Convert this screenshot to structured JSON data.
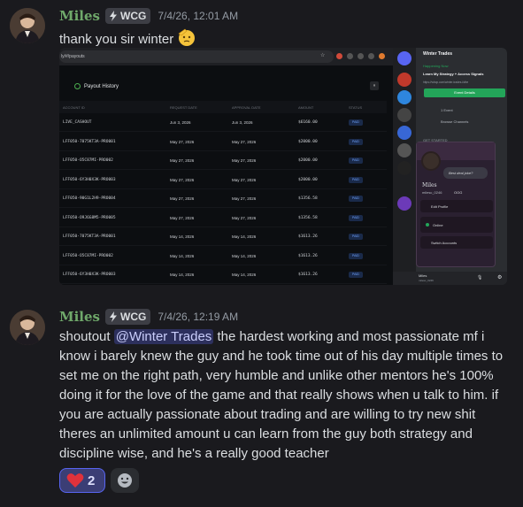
{
  "messages": [
    {
      "author": "Miles",
      "tag": "WCG",
      "timestamp": "7/4/26, 12:01 AM",
      "text": "thank you sir winter"
    },
    {
      "author": "Miles",
      "tag": "WCG",
      "timestamp": "7/4/26, 12:19 AM",
      "mention": "@Winter Trades",
      "text_before": "shoutout ",
      "text_after": " the hardest working and most passionate mf i know i barely knew the guy and he took time out of his day multiple times to set me on the right path, very humble and unlike other mentors he's 100% doing it for the love of the game and that really shows when u talk to him. if you are actually passionate about trading and are willing to try new shit theres an unlimited amount u can learn from the guy both strategy and discipline wise, and he's a really good teacher"
    }
  ],
  "attachment": {
    "url": "ly/#/payouts",
    "section_title": "Payout History",
    "columns": [
      "ACCOUNT ID",
      "REQUEST DATE",
      "APPROVAL DATE",
      "AMOUNT",
      "STATUS"
    ],
    "rows": [
      {
        "id": "LIVE_CASHOUT",
        "req": "Jun 3, 2026",
        "app": "Jun 3, 2026",
        "amt": "$6160.00",
        "status": "PAID"
      },
      {
        "id": "LFF050-7075KT3A-PRO001",
        "req": "May 27, 2026",
        "app": "May 27, 2026",
        "amt": "$2000.00",
        "status": "PAID"
      },
      {
        "id": "LFF050-O5C87MI-PRO002",
        "req": "May 27, 2026",
        "app": "May 27, 2026",
        "amt": "$2000.00",
        "status": "PAID"
      },
      {
        "id": "LFF050-6Y3H0X3K-PRO003",
        "req": "May 27, 2026",
        "app": "May 27, 2026",
        "amt": "$2000.00",
        "status": "PAID"
      },
      {
        "id": "LFF050-90G1L2H9-PRO004",
        "req": "May 27, 2026",
        "app": "May 27, 2026",
        "amt": "$1356.58",
        "status": "PAID"
      },
      {
        "id": "LFF050-O9J6G8M5-PRO005",
        "req": "May 27, 2026",
        "app": "May 27, 2026",
        "amt": "$1356.58",
        "status": "PAID"
      },
      {
        "id": "LFF050-7075KT3A-PRO001",
        "req": "May 14, 2026",
        "app": "May 14, 2026",
        "amt": "$1613.26",
        "status": "PAID"
      },
      {
        "id": "LFF050-O5C87MI-PRO002",
        "req": "May 14, 2026",
        "app": "May 14, 2026",
        "amt": "$1613.26",
        "status": "PAID"
      },
      {
        "id": "LFF050-6Y3H0X3K-PRO003",
        "req": "May 14, 2026",
        "app": "May 14, 2026",
        "amt": "$1613.26",
        "status": "PAID"
      }
    ],
    "discord": {
      "server_name": "Winter Trades",
      "happening_now": "Happening Now",
      "event_title": "Learn My Strategy + Access Signals",
      "event_link": "https://whop.com/winter-trades-iidhe",
      "event_button": "Event Details",
      "events_label": "1 Event",
      "browse_label": "Browse Channels",
      "get_started": "GET STARTED",
      "profile_status": "Best deal joke?",
      "profile_name": "Miles",
      "profile_handle": "milesc_0246",
      "profile_tag": "OOG",
      "menu": [
        "Edit Profile",
        "Online",
        "Switch Accounts"
      ],
      "footer_name": "Miles",
      "footer_handle": "milesc_0246"
    }
  },
  "reactions": [
    {
      "emoji": "heart",
      "count": "2"
    }
  ],
  "colors": {
    "username": "#6fa86a",
    "reaction_active": "#5865f2",
    "paid_badge": "#6fa3ff"
  }
}
